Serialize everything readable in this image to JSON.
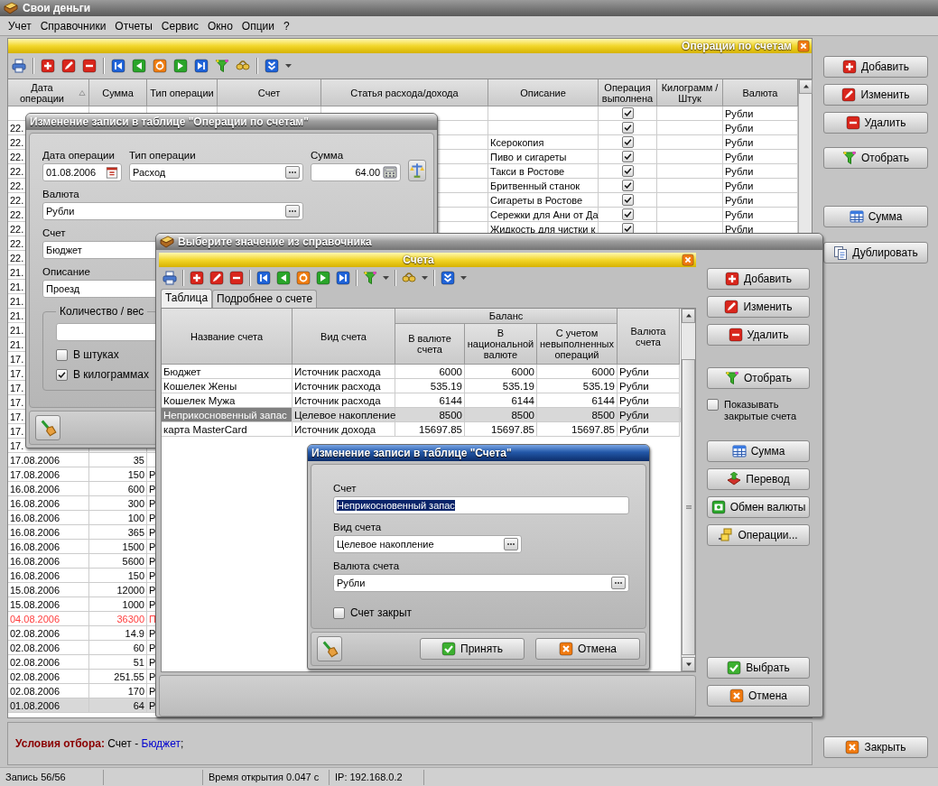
{
  "window": {
    "title": "Свои деньги"
  },
  "menu": [
    "Учет",
    "Справочники",
    "Отчеты",
    "Сервис",
    "Окно",
    "Опции",
    "?"
  ],
  "operations": {
    "title": "Операции по счетам",
    "columns": [
      {
        "label": "Дата операции",
        "sorted": true
      },
      {
        "label": "Сумма",
        "sorted": false
      },
      {
        "label": "Тип операции",
        "sorted": false
      },
      {
        "label": "Счет",
        "sorted": false
      },
      {
        "label": "Статья расхода/дохода",
        "sorted": false
      },
      {
        "label": "Описание",
        "sorted": false
      },
      {
        "label": "Операция выполнена",
        "sorted": false
      },
      {
        "label": "Килограмм / Штук",
        "sorted": false
      },
      {
        "label": "Валюта",
        "sorted": false
      }
    ],
    "rows": [
      {
        "done": true,
        "currency": "Рубли",
        "selected": false
      },
      {
        "date": "22.",
        "done": true,
        "currency": "Рубли",
        "selected": false
      },
      {
        "date": "22.",
        "description": "Ксерокопия",
        "done": true,
        "currency": "Рубли",
        "selected": false
      },
      {
        "date": "22.",
        "description": "Пиво и сигареты",
        "done": true,
        "currency": "Рубли",
        "selected": false
      },
      {
        "date": "22.",
        "description": "Такси в Ростове",
        "done": true,
        "currency": "Рубли",
        "selected": false
      },
      {
        "date": "22.",
        "description": "Бритвенный станок",
        "done": true,
        "currency": "Рубли",
        "selected": false
      },
      {
        "date": "22.",
        "description": "Сигареты в Ростове",
        "done": true,
        "currency": "Рубли",
        "selected": false
      },
      {
        "date": "22.",
        "description": "Сережки для Ани от Да",
        "done": true,
        "currency": "Рубли",
        "selected": false
      },
      {
        "date": "22.",
        "description": "Жидкость для чистки к",
        "done": true,
        "currency": "Рубли",
        "selected": false
      },
      {
        "date": "22.",
        "selected": false
      },
      {
        "date": "22.",
        "selected": false
      },
      {
        "date": "21.",
        "selected": false
      },
      {
        "date": "21.",
        "selected": false
      },
      {
        "date": "21.",
        "selected": false
      },
      {
        "date": "21.",
        "selected": false
      },
      {
        "date": "21.",
        "selected": false
      },
      {
        "date": "21.",
        "selected": false
      },
      {
        "date": "17.",
        "selected": false
      },
      {
        "date": "17.",
        "selected": false
      },
      {
        "date": "17.",
        "selected": false
      },
      {
        "date": "17.",
        "selected": false
      },
      {
        "date": "17.",
        "selected": false
      },
      {
        "date": "17.",
        "selected": false
      },
      {
        "date": "17.",
        "selected": false
      },
      {
        "date": "17.08.2006",
        "amount": "35",
        "selected": false
      },
      {
        "date": "17.08.2006",
        "amount": "150",
        "type": "Р",
        "selected": false
      },
      {
        "date": "16.08.2006",
        "amount": "600",
        "type": "Р",
        "selected": false
      },
      {
        "date": "16.08.2006",
        "amount": "300",
        "type": "Р",
        "selected": false
      },
      {
        "date": "16.08.2006",
        "amount": "100",
        "type": "Р",
        "selected": false
      },
      {
        "date": "16.08.2006",
        "amount": "365",
        "type": "Р",
        "selected": false
      },
      {
        "date": "16.08.2006",
        "amount": "1500",
        "type": "Р",
        "selected": false
      },
      {
        "date": "16.08.2006",
        "amount": "5600",
        "type": "Р",
        "selected": false
      },
      {
        "date": "16.08.2006",
        "amount": "150",
        "type": "Р",
        "selected": false
      },
      {
        "date": "15.08.2006",
        "amount": "12000",
        "type": "Р",
        "selected": false
      },
      {
        "date": "15.08.2006",
        "amount": "1000",
        "type": "Р",
        "selected": false
      },
      {
        "date": "04.08.2006",
        "amount": "36300",
        "type": "П",
        "selected": false,
        "color": "#ff4040"
      },
      {
        "date": "02.08.2006",
        "amount": "14.9",
        "type": "Р",
        "selected": false
      },
      {
        "date": "02.08.2006",
        "amount": "60",
        "type": "Р",
        "selected": false
      },
      {
        "date": "02.08.2006",
        "amount": "51",
        "type": "Р",
        "selected": false
      },
      {
        "date": "02.08.2006",
        "amount": "251.55",
        "type": "Р",
        "selected": false
      },
      {
        "date": "02.08.2006",
        "amount": "170",
        "type": "Р",
        "selected": false
      },
      {
        "date": "01.08.2006",
        "amount": "64",
        "type": "Р",
        "selected": true
      }
    ]
  },
  "side_buttons": [
    "Добавить",
    "Изменить",
    "Удалить",
    "Отобрать",
    "Сумма",
    "Дублировать"
  ],
  "close_button": "Закрыть",
  "filter": {
    "label": "Условия отбора:",
    "field": "Счет -",
    "value": "Бюджет",
    "end": ";"
  },
  "status_bar": [
    "Запись 56/56",
    "Время открытия 0.047 с",
    "IP: 192.168.0.2"
  ],
  "edit_operation": {
    "title": "Изменение записи в таблице \"Операции по счетам\"",
    "date": {
      "label": "Дата операции",
      "value": "01.08.2006"
    },
    "type": {
      "label": "Тип операции",
      "value": "Расход"
    },
    "amount": {
      "label": "Сумма",
      "value": "64.00"
    },
    "currency": {
      "label": "Валюта",
      "value": "Рубли"
    },
    "account": {
      "label": "Счет",
      "value": "Бюджет"
    },
    "description": {
      "label": "Описание",
      "value": "Проезд"
    },
    "quantity": {
      "label": "Количество / вес",
      "options": [
        {
          "label": "В штуках",
          "checked": false
        },
        {
          "label": "В килограммах",
          "checked": true
        }
      ]
    }
  },
  "picker": {
    "title": "Выберите значение из справочника",
    "panel_title": "Счета",
    "tabs": [
      {
        "label": "Таблица",
        "selected": true
      },
      {
        "label": "Подробнее о счете",
        "selected": false
      }
    ],
    "group_header": "Баланс",
    "columns": [
      "Название счета",
      "Вид счета",
      "В валюте счета",
      "В национальной валюте",
      "С учетом невыполненных операций",
      "Валюта счета"
    ],
    "rows": [
      {
        "cells": [
          "Бюджет",
          "Источник расхода",
          "6000",
          "6000",
          "6000",
          "Рубли"
        ],
        "selected": false
      },
      {
        "cells": [
          "Кошелек Жены",
          "Источник расхода",
          "535.19",
          "535.19",
          "535.19",
          "Рубли"
        ],
        "selected": false
      },
      {
        "cells": [
          "Кошелек Мужа",
          "Источник расхода",
          "6144",
          "6144",
          "6144",
          "Рубли"
        ],
        "selected": false
      },
      {
        "cells": [
          "Неприкосновенный запас",
          "Целевое накопление",
          "8500",
          "8500",
          "8500",
          "Рубли"
        ],
        "selected": true
      },
      {
        "cells": [
          "карта MasterCard",
          "Источник дохода",
          "15697.85",
          "15697.85",
          "15697.85",
          "Рубли"
        ],
        "selected": false
      }
    ],
    "buttons": [
      "Добавить",
      "Изменить",
      "Удалить",
      "Отобрать"
    ],
    "show_closed": {
      "label": "Показывать закрытые счета",
      "checked": false
    },
    "buttons2": [
      "Сумма",
      "Перевод",
      "Обмен валюты",
      "Операции..."
    ],
    "select_button": "Выбрать",
    "cancel_button": "Отмена"
  },
  "edit_account": {
    "title": "Изменение записи в таблице \"Счета\"",
    "name": {
      "label": "Счет",
      "value": "Неприкосновенный запас",
      "text_selected": true
    },
    "kind": {
      "label": "Вид счета",
      "value": "Целевое накопление"
    },
    "currency": {
      "label": "Валюта счета",
      "value": "Рубли"
    },
    "closed": {
      "label": "Счет закрыт",
      "checked": false
    },
    "ok_button": "Принять",
    "cancel_button": "Отмена"
  }
}
